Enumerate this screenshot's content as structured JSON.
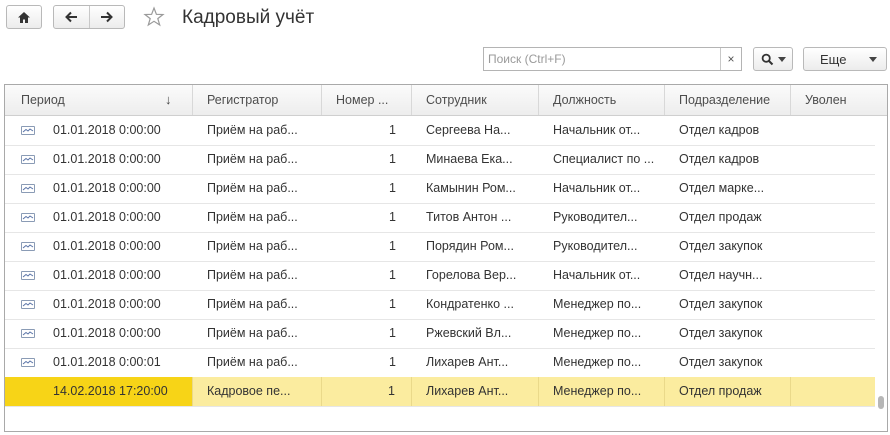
{
  "window": {
    "title": "Кадровый учёт"
  },
  "toolbar": {
    "search_placeholder": "Поиск (Ctrl+F)",
    "search_clear": "×",
    "more_label": "Еще"
  },
  "table": {
    "columns": [
      "Период",
      "Регистратор",
      "Номер ...",
      "Сотрудник",
      "Должность",
      "Подразделение",
      "Уволен"
    ],
    "sort_indicator": "↓",
    "rows": [
      {
        "period": "01.01.2018 0:00:00",
        "registrar": "Приём на раб...",
        "number": "1",
        "employee": "Сергеева На...",
        "position": "Начальник от...",
        "department": "Отдел кадров",
        "fired": ""
      },
      {
        "period": "01.01.2018 0:00:00",
        "registrar": "Приём на раб...",
        "number": "1",
        "employee": "Минаева Ека...",
        "position": "Специалист по ...",
        "department": "Отдел кадров",
        "fired": ""
      },
      {
        "period": "01.01.2018 0:00:00",
        "registrar": "Приём на раб...",
        "number": "1",
        "employee": "Камынин Ром...",
        "position": "Начальник от...",
        "department": "Отдел марке...",
        "fired": ""
      },
      {
        "period": "01.01.2018 0:00:00",
        "registrar": "Приём на раб...",
        "number": "1",
        "employee": "Титов Антон ...",
        "position": "Руководител...",
        "department": "Отдел продаж",
        "fired": ""
      },
      {
        "period": "01.01.2018 0:00:00",
        "registrar": "Приём на раб...",
        "number": "1",
        "employee": "Порядин Ром...",
        "position": "Руководител...",
        "department": "Отдел закупок",
        "fired": ""
      },
      {
        "period": "01.01.2018 0:00:00",
        "registrar": "Приём на раб...",
        "number": "1",
        "employee": "Горелова Вер...",
        "position": "Начальник от...",
        "department": "Отдел научн...",
        "fired": ""
      },
      {
        "period": "01.01.2018 0:00:00",
        "registrar": "Приём на раб...",
        "number": "1",
        "employee": "Кондратенко ...",
        "position": "Менеджер по...",
        "department": "Отдел закупок",
        "fired": ""
      },
      {
        "period": "01.01.2018 0:00:00",
        "registrar": "Приём на раб...",
        "number": "1",
        "employee": "Ржевский Вл...",
        "position": "Менеджер по...",
        "department": "Отдел закупок",
        "fired": ""
      },
      {
        "period": "01.01.2018 0:00:01",
        "registrar": "Приём на раб...",
        "number": "1",
        "employee": "Лихарев Ант...",
        "position": "Менеджер по...",
        "department": "Отдел закупок",
        "fired": ""
      },
      {
        "period": "14.02.2018 17:20:00",
        "registrar": "Кадровое пе...",
        "number": "1",
        "employee": "Лихарев Ант...",
        "position": "Менеджер по...",
        "department": "Отдел продаж",
        "fired": "",
        "selected": true
      }
    ]
  },
  "icons": [
    "home-icon",
    "back-arrow-icon",
    "forward-arrow-icon",
    "star-icon",
    "search-icon",
    "chevron-down-icon",
    "record-icon"
  ],
  "colors": {
    "selected_row": "#fbec9f",
    "selected_period_cell": "#f7d417"
  }
}
